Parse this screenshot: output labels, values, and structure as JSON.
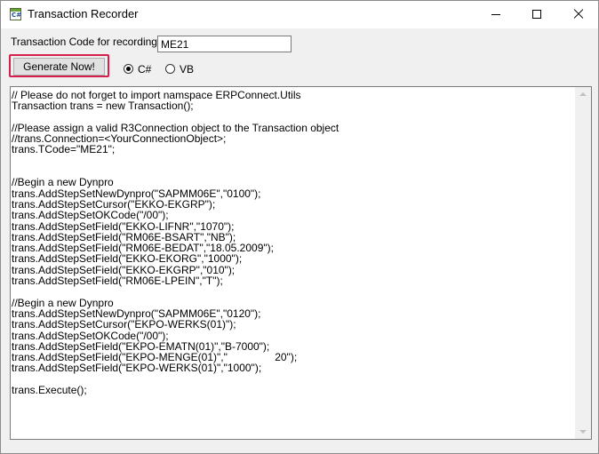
{
  "window": {
    "title": "Transaction Recorder",
    "icon": "csharp-file-icon",
    "icon_text": "C#"
  },
  "form": {
    "tcode_label": "Transaction Code for recording",
    "tcode_value": "ME21",
    "generate_label": "Generate Now!",
    "highlight_color": "#d61f4a",
    "language": {
      "selected": "C#",
      "options": [
        "C#",
        "VB"
      ]
    }
  },
  "editor": {
    "code": "// Please do not forget to import namspace ERPConnect.Utils\nTransaction trans = new Transaction();\n\n//Please assign a valid R3Connection object to the Transaction object\n//trans.Connection=<YourConnectionObject>;\ntrans.TCode=\"ME21\";\n\n\n//Begin a new Dynpro\ntrans.AddStepSetNewDynpro(\"SAPMM06E\",\"0100\");\ntrans.AddStepSetCursor(\"EKKO-EKGRP\");\ntrans.AddStepSetOKCode(\"/00\");\ntrans.AddStepSetField(\"EKKO-LIFNR\",\"1070\");\ntrans.AddStepSetField(\"RM06E-BSART\",\"NB\");\ntrans.AddStepSetField(\"RM06E-BEDAT\",\"18.05.2009\");\ntrans.AddStepSetField(\"EKKO-EKORG\",\"1000\");\ntrans.AddStepSetField(\"EKKO-EKGRP\",\"010\");\ntrans.AddStepSetField(\"RM06E-LPEIN\",\"T\");\n\n//Begin a new Dynpro\ntrans.AddStepSetNewDynpro(\"SAPMM06E\",\"0120\");\ntrans.AddStepSetCursor(\"EKPO-WERKS(01)\");\ntrans.AddStepSetOKCode(\"/00\");\ntrans.AddStepSetField(\"EKPO-EMATN(01)\",\"B-7000\");\ntrans.AddStepSetField(\"EKPO-MENGE(01)\",\"                20\");\ntrans.AddStepSetField(\"EKPO-WERKS(01)\",\"1000\");\n\ntrans.Execute();"
  }
}
